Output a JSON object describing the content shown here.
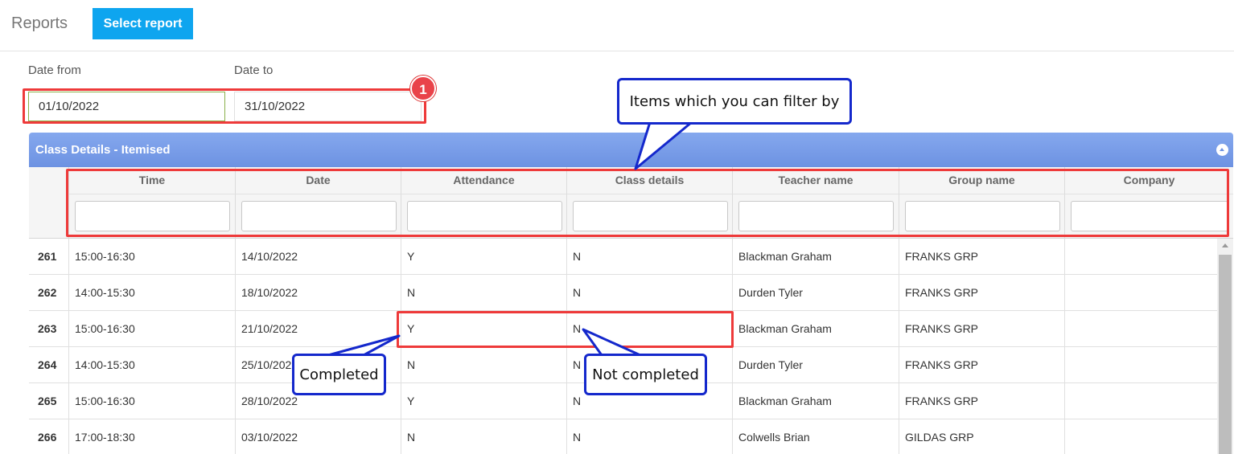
{
  "header": {
    "title": "Reports",
    "select_report_label": "Select report"
  },
  "filters": {
    "date_from_label": "Date from",
    "date_from_value": "01/10/2022",
    "date_to_label": "Date to",
    "date_to_value": "31/10/2022"
  },
  "panel": {
    "title": "Class Details - Itemised"
  },
  "table": {
    "columns": [
      "Time",
      "Date",
      "Attendance",
      "Class details",
      "Teacher name",
      "Group name",
      "Company"
    ],
    "rows": [
      {
        "num": "261",
        "time": "15:00-16:30",
        "date": "14/10/2022",
        "attendance": "Y",
        "class_details": "N",
        "teacher": "Blackman Graham",
        "group": "FRANKS GRP",
        "company": ""
      },
      {
        "num": "262",
        "time": "14:00-15:30",
        "date": "18/10/2022",
        "attendance": "N",
        "class_details": "N",
        "teacher": "Durden Tyler",
        "group": "FRANKS GRP",
        "company": ""
      },
      {
        "num": "263",
        "time": "15:00-16:30",
        "date": "21/10/2022",
        "attendance": "Y",
        "class_details": "N",
        "teacher": "Blackman Graham",
        "group": "FRANKS GRP",
        "company": ""
      },
      {
        "num": "264",
        "time": "14:00-15:30",
        "date": "25/10/2022",
        "attendance": "N",
        "class_details": "N",
        "teacher": "Durden Tyler",
        "group": "FRANKS GRP",
        "company": ""
      },
      {
        "num": "265",
        "time": "15:00-16:30",
        "date": "28/10/2022",
        "attendance": "Y",
        "class_details": "N",
        "teacher": "Blackman Graham",
        "group": "FRANKS GRP",
        "company": ""
      },
      {
        "num": "266",
        "time": "17:00-18:30",
        "date": "03/10/2022",
        "attendance": "N",
        "class_details": "N",
        "teacher": "Colwells Brian",
        "group": "GILDAS GRP",
        "company": ""
      }
    ]
  },
  "annotations": {
    "badge": "1",
    "filter_callout": "Items which you can filter by",
    "completed_callout": "Completed",
    "not_completed_callout": "Not completed"
  },
  "colors": {
    "accent_button": "#0ea5ef",
    "panel_header": "#6d92e2",
    "annotation_red": "#ee3a3a",
    "callout_blue": "#1428cc"
  }
}
